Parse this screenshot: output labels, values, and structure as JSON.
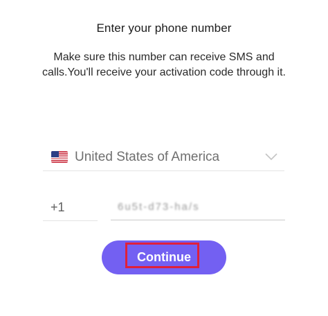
{
  "header": {
    "title": "Enter your phone number",
    "subtitle": "Make sure this number can receive SMS and calls.You'll receive your activation code through it."
  },
  "country_selector": {
    "flag_icon": "us-flag-icon",
    "selected_country": "United States of America",
    "dropdown_icon": "chevron-down-icon"
  },
  "phone": {
    "country_code": "+1",
    "number_value": "6u5t-d73-ha/s"
  },
  "actions": {
    "continue_label": "Continue"
  },
  "colors": {
    "accent": "#7360f2",
    "highlight": "#e0203a"
  }
}
